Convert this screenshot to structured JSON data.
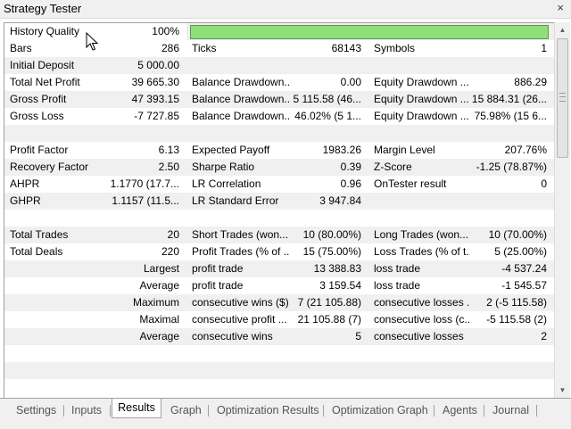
{
  "window": {
    "title": "Strategy Tester",
    "close": "×"
  },
  "quality": {
    "label": "History Quality",
    "value": "100%",
    "fill_fraction": 1.0,
    "bar_color": "#8ee078"
  },
  "rows": [
    {
      "c1l": "Bars",
      "c1v": "286",
      "c2l": "Ticks",
      "c2v": "68143",
      "c3l": "Symbols",
      "c3v": "1"
    },
    {
      "c1l": "Initial Deposit",
      "c1v": "5 000.00",
      "c2l": "",
      "c2v": "",
      "c3l": "",
      "c3v": ""
    },
    {
      "c1l": "Total Net Profit",
      "c1v": "39 665.30",
      "c2l": "Balance Drawdown...",
      "c2v": "0.00",
      "c3l": "Equity Drawdown ...",
      "c3v": "886.29"
    },
    {
      "c1l": "Gross Profit",
      "c1v": "47 393.15",
      "c2l": "Balance Drawdown...",
      "c2v": "5 115.58 (46...",
      "c3l": "Equity Drawdown ...",
      "c3v": "15 884.31 (26..."
    },
    {
      "c1l": "Gross Loss",
      "c1v": "-7 727.85",
      "c2l": "Balance Drawdown...",
      "c2v": "46.02% (5 1...",
      "c3l": "Equity Drawdown ...",
      "c3v": "75.98% (15 6..."
    },
    {
      "c1l": "",
      "c1v": "",
      "c2l": "",
      "c2v": "",
      "c3l": "",
      "c3v": ""
    },
    {
      "c1l": "Profit Factor",
      "c1v": "6.13",
      "c2l": "Expected Payoff",
      "c2v": "1983.26",
      "c3l": "Margin Level",
      "c3v": "207.76%"
    },
    {
      "c1l": "Recovery Factor",
      "c1v": "2.50",
      "c2l": "Sharpe Ratio",
      "c2v": "0.39",
      "c3l": "Z-Score",
      "c3v": "-1.25 (78.87%)"
    },
    {
      "c1l": "AHPR",
      "c1v": "1.1770 (17.7...",
      "c2l": "LR Correlation",
      "c2v": "0.96",
      "c3l": "OnTester result",
      "c3v": "0"
    },
    {
      "c1l": "GHPR",
      "c1v": "1.1157 (11.5...",
      "c2l": "LR Standard Error",
      "c2v": "3 947.84",
      "c3l": "",
      "c3v": ""
    },
    {
      "c1l": "",
      "c1v": "",
      "c2l": "",
      "c2v": "",
      "c3l": "",
      "c3v": ""
    },
    {
      "c1l": "Total Trades",
      "c1v": "20",
      "c2l": "Short Trades (won...",
      "c2v": "10 (80.00%)",
      "c3l": "Long Trades (won...",
      "c3v": "10 (70.00%)"
    },
    {
      "c1l": "Total Deals",
      "c1v": "220",
      "c2l": "Profit Trades (% of ...",
      "c2v": "15 (75.00%)",
      "c3l": "Loss Trades (% of t...",
      "c3v": "5 (25.00%)"
    },
    {
      "c1l": "",
      "c1v": "Largest",
      "c2l": "profit trade",
      "c2v": "13 388.83",
      "c3l": "loss trade",
      "c3v": "-4 537.24"
    },
    {
      "c1l": "",
      "c1v": "Average",
      "c2l": "profit trade",
      "c2v": "3 159.54",
      "c3l": "loss trade",
      "c3v": "-1 545.57"
    },
    {
      "c1l": "",
      "c1v": "Maximum",
      "c2l": "consecutive wins ($)",
      "c2v": "7 (21 105.88)",
      "c3l": "consecutive losses ...",
      "c3v": "2 (-5 115.58)"
    },
    {
      "c1l": "",
      "c1v": "Maximal",
      "c2l": "consecutive profit ...",
      "c2v": "21 105.88 (7)",
      "c3l": "consecutive loss (c...",
      "c3v": "-5 115.58 (2)"
    },
    {
      "c1l": "",
      "c1v": "Average",
      "c2l": "consecutive wins",
      "c2v": "5",
      "c3l": "consecutive losses",
      "c3v": "2"
    },
    {
      "c1l": "",
      "c1v": "",
      "c2l": "",
      "c2v": "",
      "c3l": "",
      "c3v": ""
    },
    {
      "c1l": "",
      "c1v": "",
      "c2l": "",
      "c2v": "",
      "c3l": "",
      "c3v": ""
    },
    {
      "c1l": "",
      "c1v": "",
      "c2l": "",
      "c2v": "",
      "c3l": "",
      "c3v": ""
    }
  ],
  "tabs": [
    {
      "label": "Settings",
      "active": false
    },
    {
      "label": "Inputs",
      "active": false
    },
    {
      "label": "Results",
      "active": true
    },
    {
      "label": "Graph",
      "active": false
    },
    {
      "label": "Optimization Results",
      "active": false
    },
    {
      "label": "Optimization Graph",
      "active": false
    },
    {
      "label": "Agents",
      "active": false
    },
    {
      "label": "Journal",
      "active": false
    }
  ],
  "icons": {
    "scroll_up": "scroll-up-arrow-icon",
    "scroll_down": "scroll-down-arrow-icon",
    "cursor": "mouse-pointer-icon"
  }
}
